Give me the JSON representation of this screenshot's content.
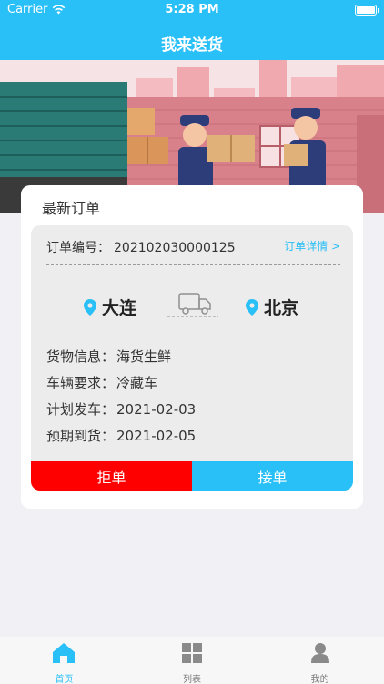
{
  "status_bar": {
    "carrier": "Carrier",
    "time": "5:28 PM"
  },
  "nav": {
    "title": "我来送货"
  },
  "card": {
    "title": "最新订单",
    "order_label": "订单编号：",
    "order_no": "202102030000125",
    "detail_link": "订单详情 >",
    "from_city": "大连",
    "to_city": "北京",
    "info": [
      {
        "label": "货物信息：",
        "value": "海货生鲜"
      },
      {
        "label": "车辆要求：",
        "value": "冷藏车"
      },
      {
        "label": "计划发车：",
        "value": "2021-02-03"
      },
      {
        "label": "预期到货：",
        "value": "2021-02-05"
      }
    ],
    "reject_label": "拒单",
    "accept_label": "接单"
  },
  "tabbar": {
    "items": [
      {
        "label": "首页",
        "icon": "home-icon",
        "active": true
      },
      {
        "label": "列表",
        "icon": "grid-icon",
        "active": false
      },
      {
        "label": "我的",
        "icon": "person-icon",
        "active": false
      }
    ]
  },
  "colors": {
    "primary": "#29bff7",
    "reject": "#ff0000",
    "background": "#f1f1f5"
  }
}
